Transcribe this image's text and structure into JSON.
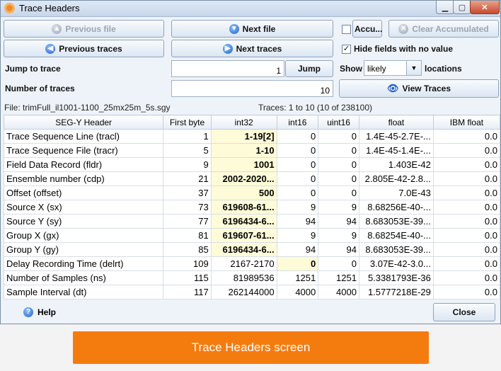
{
  "window": {
    "title": "Trace Headers"
  },
  "buttons": {
    "previous_file": "Previous file",
    "next_file": "Next file",
    "accumulate": "Accu...",
    "clear_accumulated": "Clear Accumulated",
    "previous_traces": "Previous traces",
    "next_traces": "Next traces",
    "jump": "Jump",
    "view_traces": "View Traces",
    "help": "Help",
    "close": "Close"
  },
  "options": {
    "hide_fields_label": "Hide fields with no value",
    "hide_fields_checked": true,
    "accumulate_checked": false,
    "show_label": "Show",
    "show_value": "likely",
    "locations_label": "locations"
  },
  "inputs": {
    "jump_label": "Jump to trace",
    "jump_value": "1",
    "count_label": "Number of traces",
    "count_value": "10"
  },
  "status": {
    "file": "File: trimFull_il1001-1100_25mx25m_5s.sgy",
    "traces": "Traces: 1 to 10 (10 of 238100)"
  },
  "table": {
    "columns": [
      "SEG-Y Header",
      "First byte",
      "int32",
      "int16",
      "uint16",
      "float",
      "IBM float"
    ],
    "rows": [
      [
        "Trace Sequence Line (tracl)",
        "1",
        "1-19[2]",
        "0",
        "0",
        "1.4E-45-2.7E-...",
        "0.0"
      ],
      [
        "Trace Sequence File (tracr)",
        "5",
        "1-10",
        "0",
        "0",
        "1.4E-45-1.4E-...",
        "0.0"
      ],
      [
        "Field Data Record (fldr)",
        "9",
        "1001",
        "0",
        "0",
        "1.403E-42",
        "0.0"
      ],
      [
        "Ensemble number (cdp)",
        "21",
        "2002-2020...",
        "0",
        "0",
        "2.805E-42-2.8...",
        "0.0"
      ],
      [
        "Offset (offset)",
        "37",
        "500",
        "0",
        "0",
        "7.0E-43",
        "0.0"
      ],
      [
        "Source X (sx)",
        "73",
        "619608-61...",
        "9",
        "9",
        "8.68256E-40-...",
        "0.0"
      ],
      [
        "Source Y (sy)",
        "77",
        "6196434-6...",
        "94",
        "94",
        "8.683053E-39...",
        "0.0"
      ],
      [
        "Group X (gx)",
        "81",
        "619607-61...",
        "9",
        "9",
        "8.68254E-40-...",
        "0.0"
      ],
      [
        "Group Y (gy)",
        "85",
        "6196434-6...",
        "94",
        "94",
        "8.683053E-39...",
        "0.0"
      ],
      [
        "Delay Recording Time (delrt)",
        "109",
        "2167-2170",
        "0",
        "0",
        "3.07E-42-3.0...",
        "0.0"
      ],
      [
        "Number of Samples (ns)",
        "115",
        "81989536",
        "1251",
        "1251",
        "5.3381793E-36",
        "0.0"
      ],
      [
        "Sample Interval (dt)",
        "117",
        "262144000",
        "4000",
        "4000",
        "1.5777218E-29",
        "0.0"
      ]
    ],
    "highlight": [
      [
        false,
        false,
        true,
        false,
        false,
        false,
        false
      ],
      [
        false,
        false,
        true,
        false,
        false,
        false,
        false
      ],
      [
        false,
        false,
        true,
        false,
        false,
        false,
        false
      ],
      [
        false,
        false,
        true,
        false,
        false,
        false,
        false
      ],
      [
        false,
        false,
        true,
        false,
        false,
        false,
        false
      ],
      [
        false,
        false,
        true,
        false,
        false,
        false,
        false
      ],
      [
        false,
        false,
        true,
        false,
        false,
        false,
        false
      ],
      [
        false,
        false,
        true,
        false,
        false,
        false,
        false
      ],
      [
        false,
        false,
        true,
        false,
        false,
        false,
        false
      ],
      [
        false,
        false,
        false,
        true,
        false,
        false,
        false
      ],
      [
        false,
        false,
        false,
        false,
        false,
        false,
        false
      ],
      [
        false,
        false,
        false,
        false,
        false,
        false,
        false
      ]
    ]
  },
  "banner": {
    "text": "Trace Headers screen"
  }
}
